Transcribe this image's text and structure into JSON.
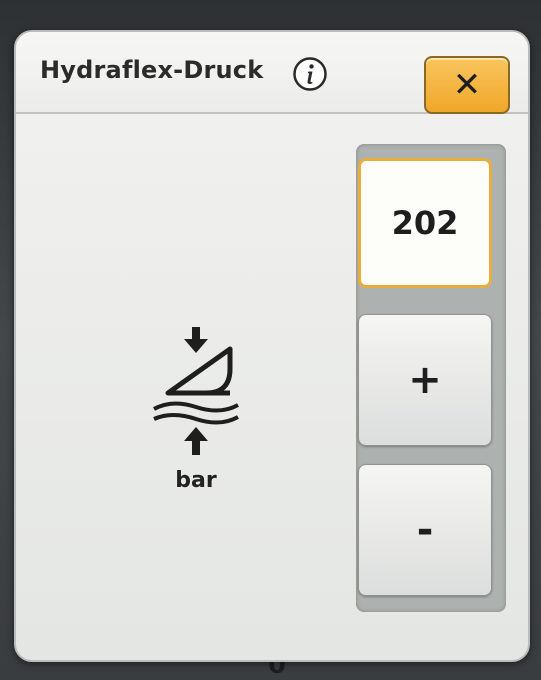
{
  "dialog": {
    "title": "Hydraflex-Druck",
    "info_icon": "info-icon",
    "close_label": "✕"
  },
  "parameter": {
    "icon": "pressure-cylinder-icon",
    "unit": "bar"
  },
  "control": {
    "value": "202",
    "increment_label": "+",
    "decrement_label": "-"
  },
  "background": {
    "partial_glyph": "0"
  },
  "colors": {
    "accent": "#f0a72a",
    "selected_border": "#e9ad3d",
    "panel": "#adb1b0"
  }
}
